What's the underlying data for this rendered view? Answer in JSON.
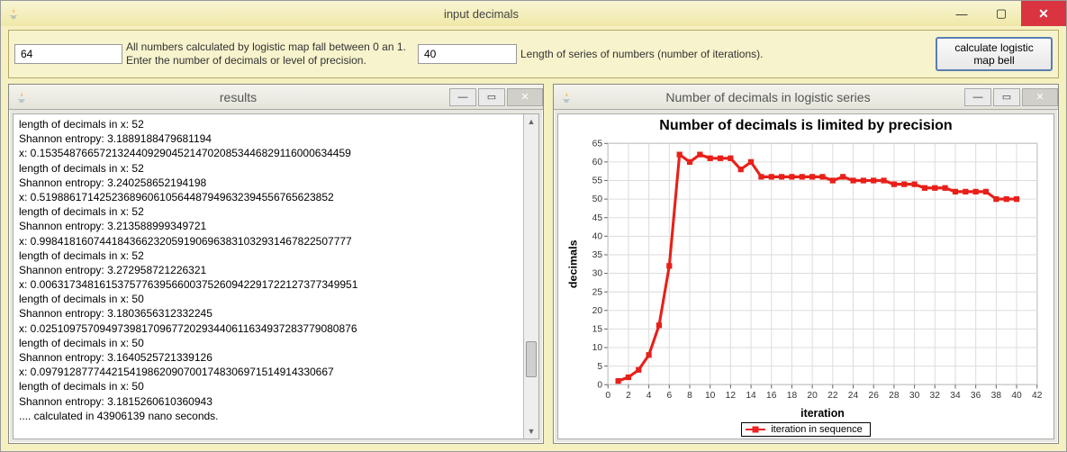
{
  "mainWindow": {
    "title": "input decimals",
    "minimizeGlyph": "—",
    "maximizeGlyph": "▢",
    "closeGlyph": "✕"
  },
  "toolbar": {
    "decimalsValue": "64",
    "decimalsLabel": "All numbers calculated by logistic map fall between 0 an 1.\nEnter the number of decimals or level of precision.",
    "iterationsValue": "40",
    "iterationsLabel": "Length of series of numbers (number of iterations).",
    "calcButton": "calculate logistic map bell"
  },
  "resultsFrame": {
    "title": "results",
    "minimizeGlyph": "—",
    "maximizeGlyph": "▭",
    "closeGlyph": "✕",
    "lines": [
      "length of decimals in x: 52",
      "Shannon entropy: 3.1889188479681194",
      "x: 0.1535487665721324409290452147020853446829116000634459",
      "length of decimals in x: 52",
      "Shannon entropy: 3.240258652194198",
      "x: 0.5198861714252368960610564487949632394556765623852",
      "length of decimals in x: 52",
      "Shannon entropy: 3.213588999349721",
      "x: 0.9984181607441843662320591906963831032931467822507777",
      "length of decimals in x: 52",
      "Shannon entropy: 3.272958721226321",
      "x: 0.00631734816153757763956600375260942291722127377349951",
      "length of decimals in x: 50",
      "Shannon entropy: 3.1803656312332245",
      "x: 0.02510975709497398170967720293440611634937283779080876",
      "length of decimals in x: 50",
      "Shannon entropy: 3.1640525721339126",
      "x: 0.0979128777442154198620907001748306971514914330667",
      "length of decimals in x: 50",
      "Shannon entropy: 3.1815260610360943",
      ".... calculated in 43906139 nano seconds."
    ]
  },
  "chartFrame": {
    "title": "Number of decimals in logistic series",
    "minimizeGlyph": "—",
    "maximizeGlyph": "▭",
    "closeGlyph": "✕"
  },
  "chart_data": {
    "type": "line",
    "title": "Number of decimals is limited by precision",
    "xlabel": "iteration",
    "ylabel": "decimals",
    "xlim": [
      0,
      42
    ],
    "ylim": [
      0,
      65
    ],
    "xticks": [
      0,
      2,
      4,
      6,
      8,
      10,
      12,
      14,
      16,
      18,
      20,
      22,
      24,
      26,
      28,
      30,
      32,
      34,
      36,
      38,
      40,
      42
    ],
    "yticks": [
      0,
      5,
      10,
      15,
      20,
      25,
      30,
      35,
      40,
      45,
      50,
      55,
      60,
      65
    ],
    "series": [
      {
        "name": "iteration in sequence",
        "color": "#e8201a",
        "x": [
          1,
          2,
          3,
          4,
          5,
          6,
          7,
          8,
          9,
          10,
          11,
          12,
          13,
          14,
          15,
          16,
          17,
          18,
          19,
          20,
          21,
          22,
          23,
          24,
          25,
          26,
          27,
          28,
          29,
          30,
          31,
          32,
          33,
          34,
          35,
          36,
          37,
          38,
          39,
          40
        ],
        "y": [
          1,
          2,
          4,
          8,
          16,
          32,
          62,
          60,
          62,
          61,
          61,
          61,
          58,
          60,
          56,
          56,
          56,
          56,
          56,
          56,
          56,
          55,
          56,
          55,
          55,
          55,
          55,
          54,
          54,
          54,
          53,
          53,
          53,
          52,
          52,
          52,
          52,
          50,
          50,
          50
        ]
      }
    ],
    "legend": {
      "position": "bottom",
      "entries": [
        "iteration in sequence"
      ]
    }
  }
}
